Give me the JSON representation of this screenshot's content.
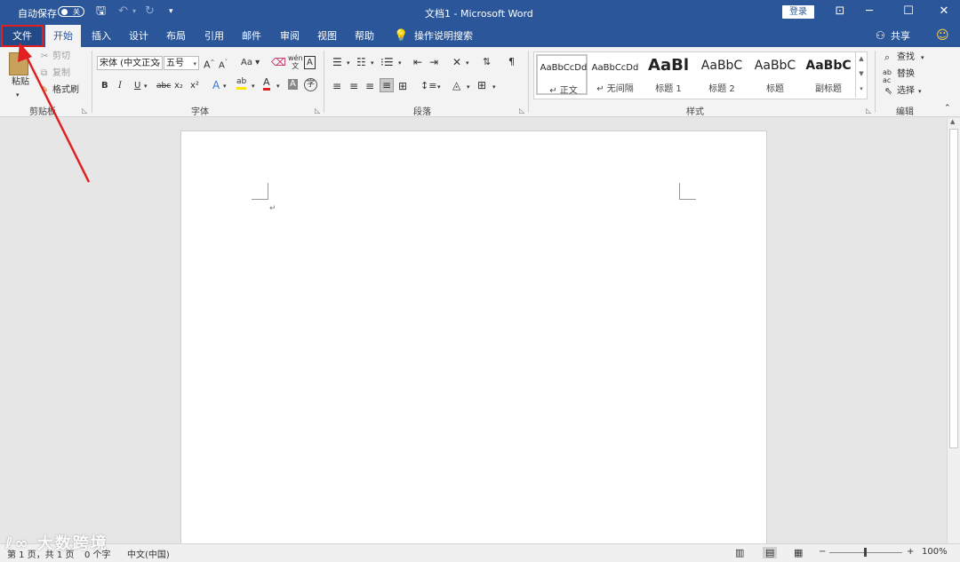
{
  "titlebar": {
    "autosave_label": "自动保存",
    "autosave_state": "关",
    "doc_title": "文档1  -  Microsoft Word",
    "login_label": "登录",
    "icons": [
      "save-icon",
      "undo-icon",
      "redo-icon",
      "customize-qat-icon",
      "ribbon-display-icon",
      "minimize-icon",
      "maximize-icon",
      "close-icon"
    ]
  },
  "tabs": [
    {
      "label": "文件"
    },
    {
      "label": "开始"
    },
    {
      "label": "插入"
    },
    {
      "label": "设计"
    },
    {
      "label": "布局"
    },
    {
      "label": "引用"
    },
    {
      "label": "邮件"
    },
    {
      "label": "审阅"
    },
    {
      "label": "视图"
    },
    {
      "label": "帮助"
    }
  ],
  "tell_me": "操作说明搜索",
  "share_label": "共享",
  "ribbon": {
    "clipboard": {
      "paste": "粘贴",
      "cut": "剪切",
      "copy": "复制",
      "format_painter": "格式刷",
      "group": "剪贴板"
    },
    "font": {
      "font_name": "宋体 (中文正文",
      "font_size": "五号",
      "bold": "B",
      "italic": "I",
      "underline": "U",
      "strike": "abc",
      "subscript": "x₂",
      "superscript": "x²",
      "change_case": "Aa",
      "wen": "文",
      "group": "字体"
    },
    "paragraph": {
      "group": "段落"
    },
    "styles": {
      "items": [
        {
          "sample": "AaBbCcDd",
          "name": "↵ 正文"
        },
        {
          "sample": "AaBbCcDd",
          "name": "↵ 无间隔"
        },
        {
          "sample": "AaBl",
          "name": "标题 1"
        },
        {
          "sample": "AaBbC",
          "name": "标题 2"
        },
        {
          "sample": "AaBbC",
          "name": "标题"
        },
        {
          "sample": "AaBbC",
          "name": "副标题"
        }
      ],
      "group": "样式"
    },
    "editing": {
      "find": "查找",
      "replace": "替换",
      "select": "选择",
      "group": "编辑"
    }
  },
  "status": {
    "page": "第 1 页，共 1 页",
    "words": "0 个字",
    "language": "中文(中国)",
    "zoom": "100%"
  },
  "watermark": "大数跨境",
  "colors": {
    "accent": "#2b579a",
    "annotation": "#e02020"
  }
}
